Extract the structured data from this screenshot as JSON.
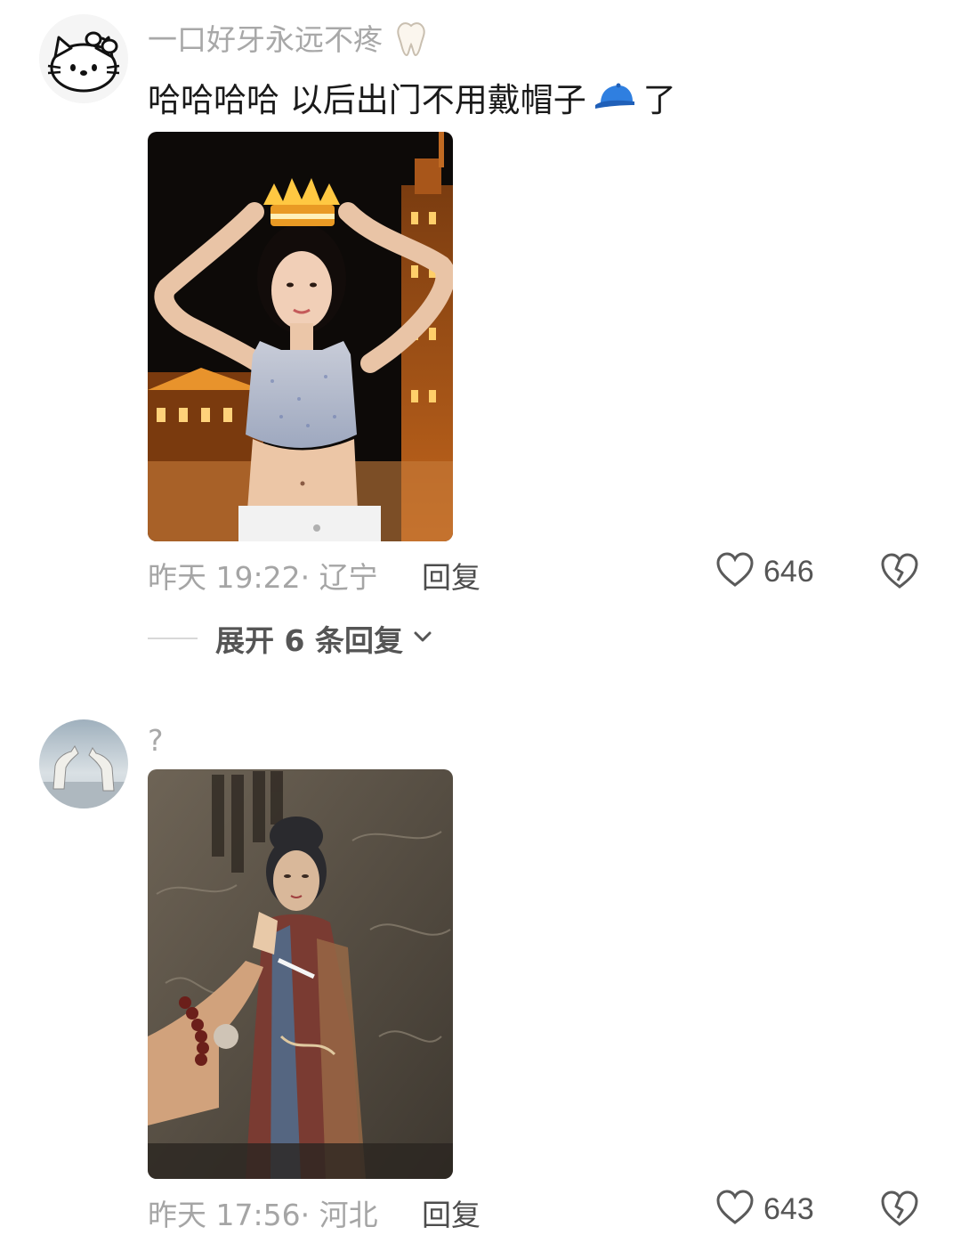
{
  "comments": [
    {
      "username": "一口好牙永远不疼",
      "username_emoji": "tooth-icon",
      "text_before": "哈哈哈哈 以后出门不用戴帽子",
      "text_emoji": "blue-cap-icon",
      "text_after": "了",
      "time_location": "昨天 19:22· 辽宁",
      "reply_label": "回复",
      "like_count": "646",
      "expand_label": "展开 6 条回复"
    },
    {
      "username": "?",
      "time_location": "昨天 17:56· 河北",
      "reply_label": "回复",
      "like_count": "643"
    }
  ],
  "colors": {
    "meta_gray": "#a5a5a5",
    "text_dark": "#1a1a1a",
    "cap_blue": "#2f7fe0"
  }
}
